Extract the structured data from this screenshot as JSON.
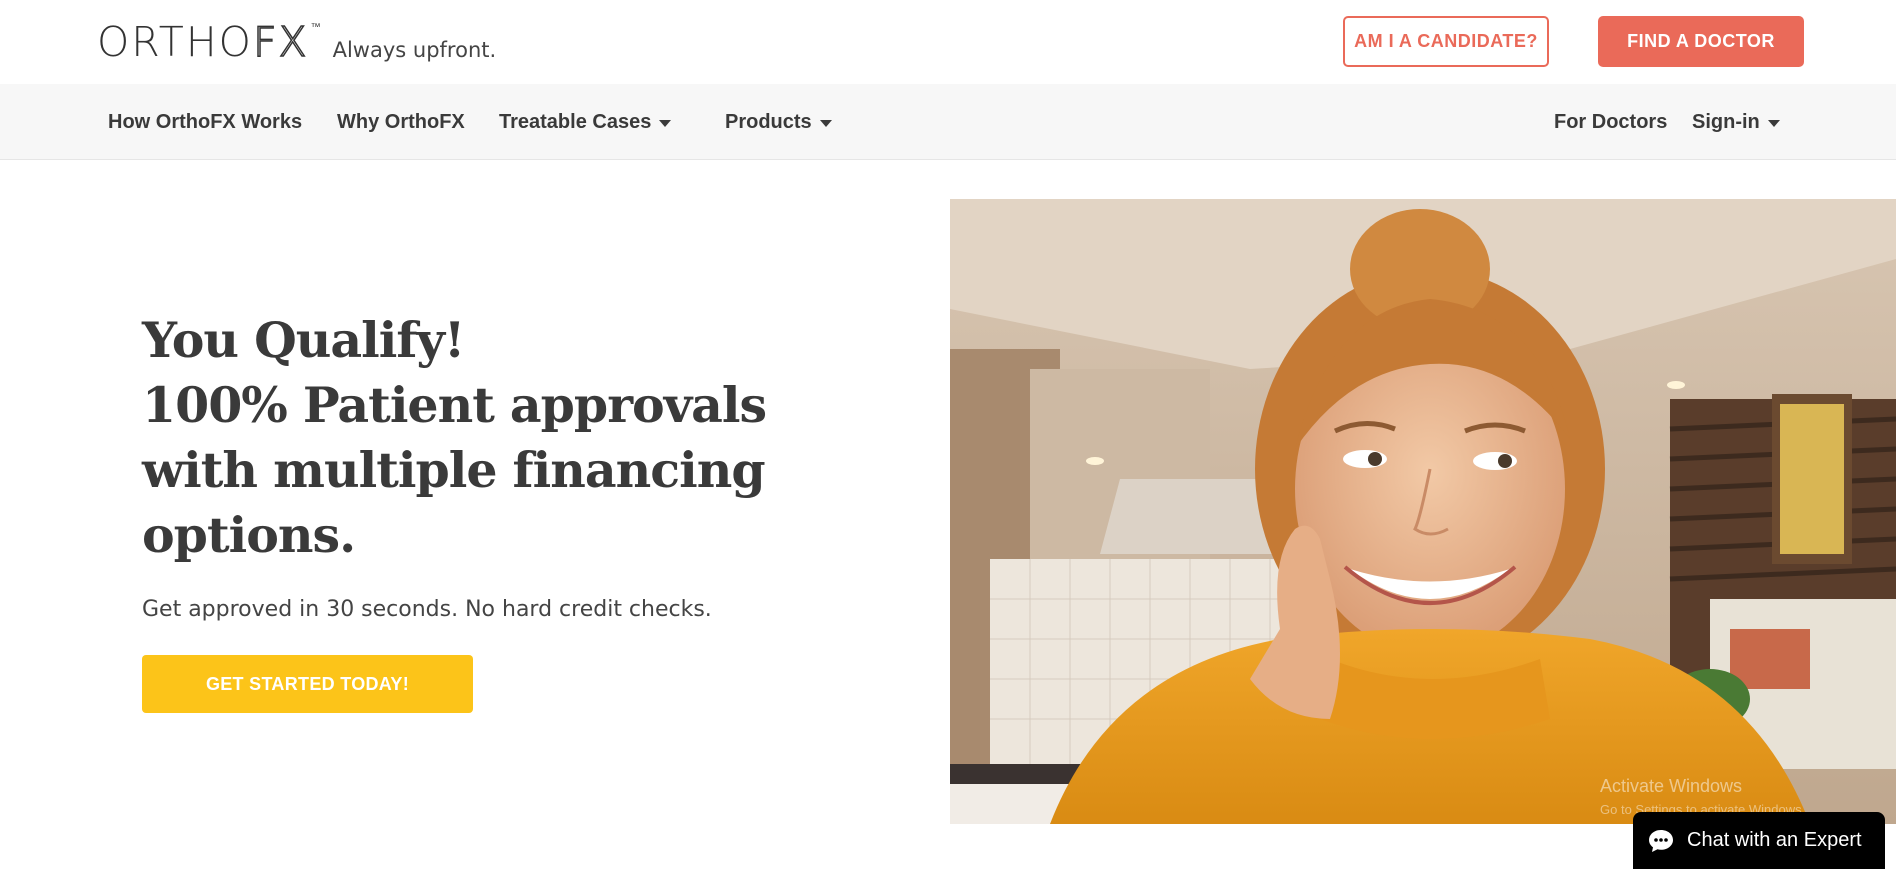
{
  "header": {
    "logo_text_left": "ORTHO",
    "logo_text_right": "FX",
    "logo_tm": "™",
    "tagline": "Always upfront.",
    "candidate_button": "AM I A CANDIDATE?",
    "find_doctor_button": "FIND A DOCTOR"
  },
  "nav": {
    "items": [
      {
        "label": "How OrthoFX Works"
      },
      {
        "label": "Why OrthoFX"
      },
      {
        "label": "Treatable Cases"
      },
      {
        "label": "Products"
      }
    ],
    "right_items": [
      {
        "label": "For Doctors"
      },
      {
        "label": "Sign-in"
      }
    ]
  },
  "hero": {
    "title_lines": [
      "You Qualify!",
      "100% Patient approvals",
      "with multiple financing",
      "options."
    ],
    "subtitle": "Get approved in 30 seconds. No hard credit checks.",
    "cta_label": "GET STARTED TODAY!"
  },
  "os_watermark": {
    "line1": "Activate Windows",
    "line2": "Go to Settings to activate Windows."
  },
  "chat": {
    "label": "Chat with an Expert",
    "icon": "chat-bubble-icon"
  },
  "colors": {
    "brand_coral": "#ea6a59",
    "cta_yellow": "#fcc419",
    "text_dark": "#3a3a3a",
    "nav_bg": "#f7f7f7"
  }
}
